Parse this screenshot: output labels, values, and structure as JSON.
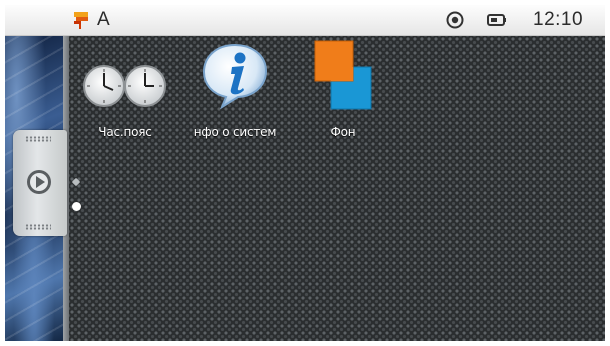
{
  "status_bar": {
    "flag_icon": "flag-icon",
    "letter": "A",
    "target_icon": "target-icon",
    "battery_icon": "battery-icon",
    "time": "12:10"
  },
  "apps": [
    {
      "label": "Час.пояс",
      "icon": "world-clocks-icon"
    },
    {
      "label": "нфо о систем",
      "icon": "info-icon"
    },
    {
      "label": "Фон",
      "icon": "wallpaper-icon"
    }
  ],
  "side_handle": {
    "icon": "play-icon"
  },
  "colors": {
    "accent_orange": "#f07d1a",
    "accent_blue": "#1a97d5"
  },
  "pages": {
    "count": 2,
    "current": 2
  }
}
